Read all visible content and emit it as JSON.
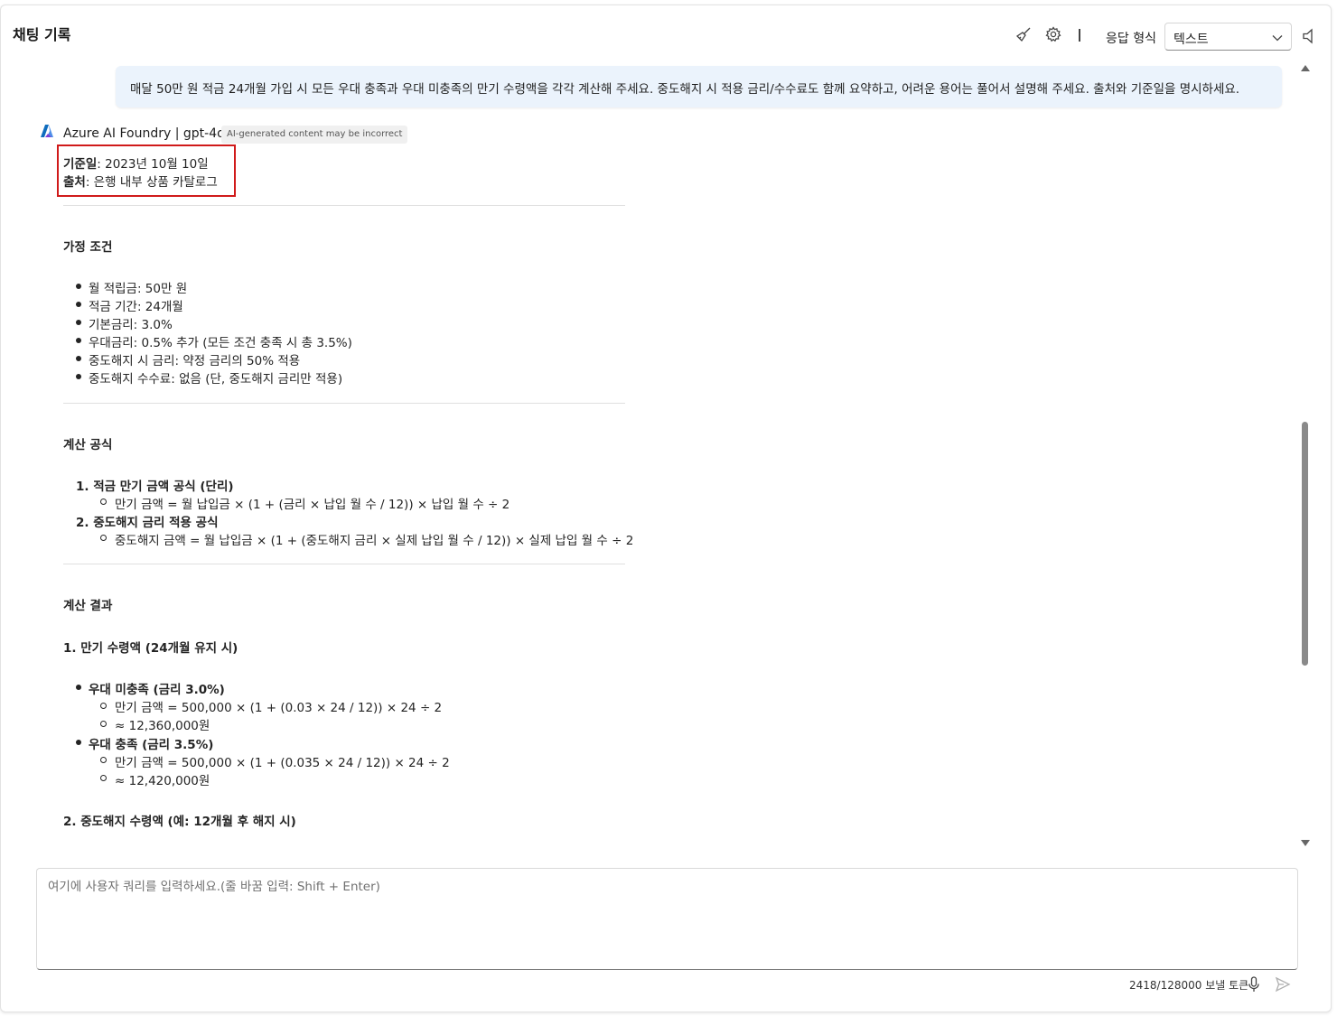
{
  "header": {
    "title": "채팅 기록",
    "icons": [
      "clear-chat-broom-icon",
      "settings-gear-icon",
      "speaker-icon"
    ],
    "response_format_label": "응답 형식",
    "response_format_value": "텍스트"
  },
  "user_message": "매달 50만 원 적금 24개월 가입 시 모든 우대 충족과 우대 미충족의 만기 수령액을 각각 계산해 주세요. 중도해지 시 적용 금리/수수료도 함께 요약하고, 어려운 용어는 풀어서 설명해 주세요. 출처와 기준일을 명시하세요.",
  "assistant": {
    "name": "Azure AI Foundry | gpt-4o",
    "badge": "AI-generated content may be incorrect",
    "base_date_label": "기준일",
    "base_date_value": ": 2023년 10월 10일",
    "source_label": "출처",
    "source_value": ": 은행 내부 상품 카탈로그",
    "assumptions": {
      "heading": "가정 조건",
      "items": [
        "월 적립금: 50만 원",
        "적금 기간: 24개월",
        "기본금리: 3.0%",
        "우대금리: 0.5% 추가 (모든 조건 충족 시 총 3.5%)",
        "중도해지 시 금리: 약정 금리의 50% 적용",
        "중도해지 수수료: 없음 (단, 중도해지 금리만 적용)"
      ]
    },
    "formulas": {
      "heading": "계산 공식",
      "items": [
        {
          "title": "1. 적금 만기 금액 공식 (단리)",
          "sub": "만기 금액 = 월 납입금 × (1 + (금리 × 납입 월 수 / 12)) × 납입 월 수 ÷ 2"
        },
        {
          "title": "2. 중도해지 금리 적용 공식",
          "sub": "중도해지 금액 = 월 납입금 × (1 + (중도해지 금리 × 실제 납입 월 수 / 12)) × 실제 납입 월 수 ÷ 2"
        }
      ]
    },
    "results": {
      "heading": "계산 결과",
      "section1": "1. 만기 수령액 (24개월 유지 시)",
      "cases": [
        {
          "title": "우대 미충족 (금리 3.0%)",
          "formula": "만기 금액 = 500,000 × (1 + (0.03 × 24 / 12)) × 24 ÷ 2",
          "result": "≈ 12,360,000원"
        },
        {
          "title": "우대 충족 (금리 3.5%)",
          "formula": "만기 금액 = 500,000 × (1 + (0.035 × 24 / 12)) × 24 ÷ 2",
          "result": "≈ 12,420,000원"
        }
      ],
      "section2": "2. 중도해지 수령액 (예: 12개월 후 해지 시)"
    }
  },
  "composer": {
    "placeholder": "여기에 사용자 쿼리를 입력하세요.(줄 바꿈 입력: Shift + Enter)",
    "token_info": "2418/128000 보낼 토큰"
  },
  "colors": {
    "user_bubble": "#ebf3fc",
    "highlight_border": "#d01a1a",
    "accent": "#0f6cbd"
  }
}
